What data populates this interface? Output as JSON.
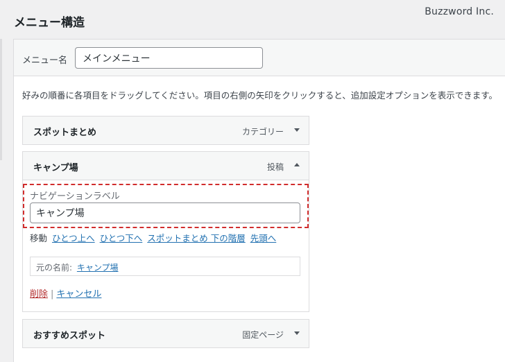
{
  "watermark": "Buzzword Inc.",
  "page_title": "メニュー構造",
  "menu_name": {
    "label": "メニュー名",
    "value": "メインメニュー"
  },
  "instructions": "好みの順番に各項目をドラッグしてください。項目の右側の矢印をクリックすると、追加設定オプションを表示できます。",
  "items": [
    {
      "title": "スポットまとめ",
      "type": "カテゴリー",
      "arrow": "chevron-down-icon"
    },
    {
      "title": "キャンプ場",
      "type": "投稿",
      "arrow": "chevron-up-icon"
    },
    {
      "title": "おすすめスポット",
      "type": "固定ページ",
      "arrow": "chevron-down-icon"
    }
  ],
  "expanded": {
    "nav_label_caption": "ナビゲーションラベル",
    "nav_label_value": "キャンプ場",
    "move_label": "移動",
    "move_links": [
      "ひとつ上へ",
      "ひとつ下へ",
      "スポットまとめ 下の階層",
      "先頭へ"
    ],
    "original_label": "元の名前:",
    "original_link": "キャンプ場",
    "delete_label": "削除",
    "separator": "|",
    "cancel_label": "キャンセル"
  },
  "colors": {
    "highlight": "#d12d2d",
    "link": "#2271b1",
    "delete": "#b32d2e"
  }
}
